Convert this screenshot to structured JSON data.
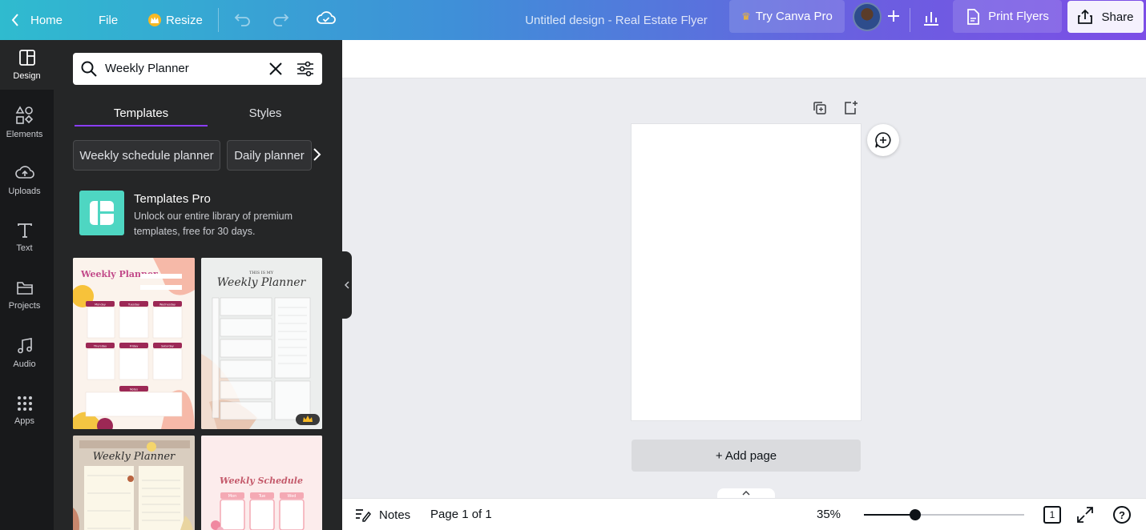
{
  "topbar": {
    "home_label": "Home",
    "file_label": "File",
    "resize_label": "Resize",
    "design_title": "Untitled design - Real Estate Flyer",
    "try_pro_label": "Try Canva Pro",
    "print_label": "Print Flyers",
    "share_label": "Share"
  },
  "rail": {
    "items": [
      {
        "label": "Design",
        "icon": "design-icon"
      },
      {
        "label": "Elements",
        "icon": "elements-icon"
      },
      {
        "label": "Uploads",
        "icon": "uploads-icon"
      },
      {
        "label": "Text",
        "icon": "text-icon"
      },
      {
        "label": "Projects",
        "icon": "projects-icon"
      },
      {
        "label": "Audio",
        "icon": "audio-icon"
      },
      {
        "label": "Apps",
        "icon": "apps-icon"
      }
    ],
    "active": "Design"
  },
  "panel": {
    "search_value": "Weekly Planner",
    "tabs": [
      {
        "label": "Templates",
        "active": true
      },
      {
        "label": "Styles",
        "active": false
      }
    ],
    "chips": [
      "Weekly schedule planner",
      "Daily planner"
    ],
    "promo": {
      "title": "Templates Pro",
      "subtitle": "Unlock our entire library of premium templates, free for 30 days."
    },
    "templates": [
      {
        "title": "Weekly Planner",
        "days": [
          "Monday",
          "Tuesday",
          "Wednesday",
          "Thursday",
          "Friday",
          "Saturday"
        ],
        "notes": "Notes"
      },
      {
        "title_small": "THIS IS MY",
        "title": "Weekly Planner",
        "pro": true
      },
      {
        "title": "Weekly Planner"
      },
      {
        "title": "Weekly Schedule",
        "days": [
          "Mon",
          "Tue",
          "Wed"
        ]
      }
    ]
  },
  "canvas": {
    "add_page_label": "+ Add page"
  },
  "bottombar": {
    "notes_label": "Notes",
    "page_info": "Page 1 of 1",
    "zoom": "35%",
    "zoom_fraction": 0.32,
    "page_count": "1",
    "help": "?"
  },
  "colors": {
    "accent": "#8b3dff",
    "panel_bg": "#252627",
    "rail_bg": "#18191b",
    "canvas_bg": "#ebecf0",
    "crown": "#f7b924",
    "promo_logo": "#4ed6c2"
  }
}
